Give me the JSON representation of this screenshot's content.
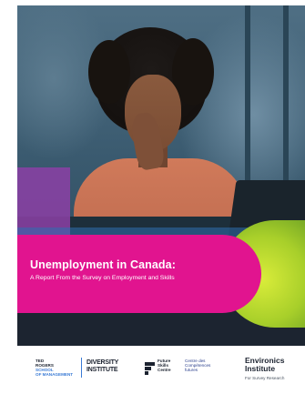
{
  "cover": {
    "title": "Unemployment in Canada:",
    "subtitle": "A Report From the Survey on Employment and Skills",
    "colors": {
      "banner": "#e1148f",
      "purple_overlay": "#8c3fa6",
      "lime_accent": "#a8cf2a",
      "dark_band": "#1c2430"
    }
  },
  "footer": {
    "logos": {
      "ted_rogers": {
        "line1": "TED",
        "line2": "ROGERS",
        "line3": "SCHOOL",
        "line4": "OF MANAGEMENT"
      },
      "diversity_institute": {
        "line1": "DIVERSITY",
        "line2": "INSTITUTE"
      },
      "future_skills": {
        "line1": "Future",
        "line2": "Skills",
        "line3": "Centre",
        "fr_line1": "Centre des",
        "fr_line2": "Compétences",
        "fr_line3": "futures"
      },
      "environics": {
        "line1": "Environics",
        "line2": "Institute",
        "sub": "For Survey Research"
      }
    }
  }
}
